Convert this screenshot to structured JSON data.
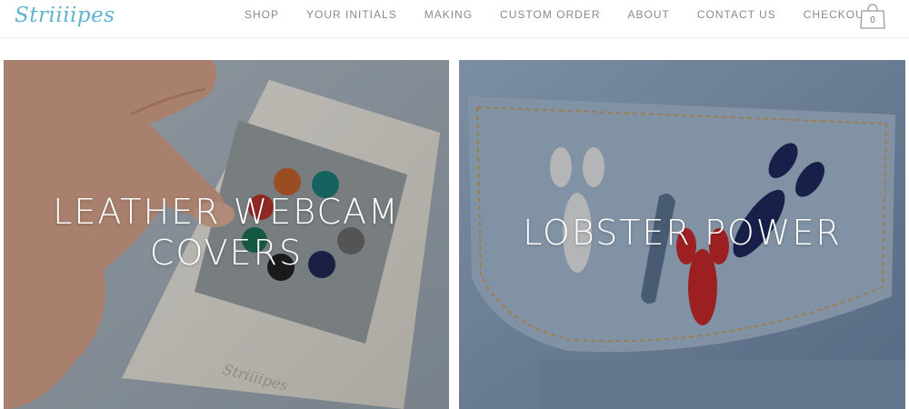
{
  "site": {
    "logo_text": "Striiiipes"
  },
  "nav": {
    "items": [
      "SHOP",
      "YOUR INITIALS",
      "MAKING",
      "CUSTOM ORDER",
      "ABOUT",
      "CONTACT US",
      "CHECKOUT"
    ]
  },
  "cart": {
    "count": "0",
    "icon": "shopping-bag-icon"
  },
  "tiles": [
    {
      "title": "LEATHER WEBCAM COVERS",
      "image": "hand holding leather webcam cover card with colored dots"
    },
    {
      "title": "LOBSTER POWER",
      "image": "lobster enamel pins on denim jacket pocket"
    }
  ],
  "colors": {
    "logo": "#5fb3cf",
    "nav": "#8a8a8a",
    "overlay_text": "#ffffff"
  }
}
